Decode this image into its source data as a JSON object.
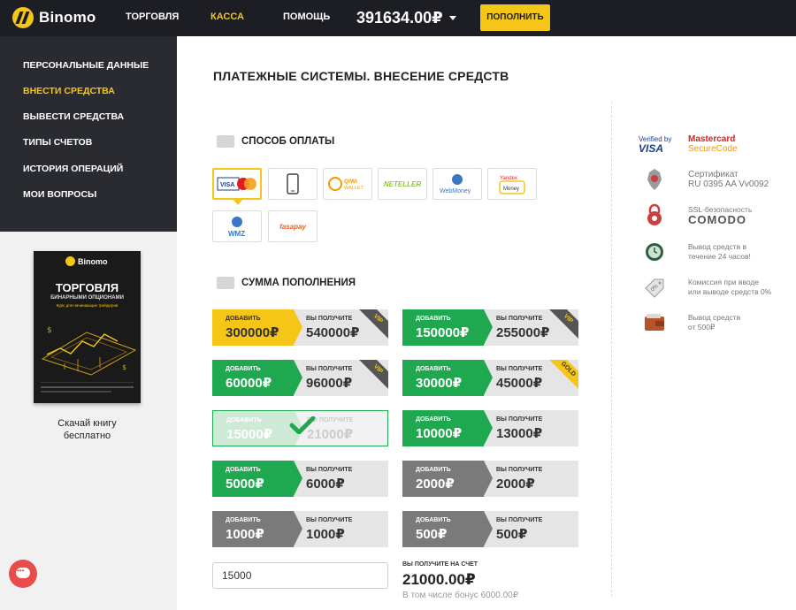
{
  "header": {
    "logo_text": "Binomo",
    "nav": [
      "ТОРГОВЛЯ",
      "КАССА",
      "ПОМОЩЬ"
    ],
    "active_nav": "КАССА",
    "balance": "391634.00₽",
    "deposit_button": "ПОПОЛНИТЬ"
  },
  "sidebar": {
    "items": [
      {
        "label": "ПЕРСОНАЛЬНЫЕ ДАННЫЕ",
        "active": false
      },
      {
        "label": "ВНЕСТИ СРЕДСТВА",
        "active": true
      },
      {
        "label": "ВЫВЕСТИ СРЕДСТВА",
        "active": false
      },
      {
        "label": "ТИПЫ СЧЕТОВ",
        "active": false
      },
      {
        "label": "ИСТОРИЯ ОПЕРАЦИЙ",
        "active": false
      },
      {
        "label": "МОИ ВОПРОСЫ",
        "active": false
      }
    ],
    "book": {
      "logo": "Binomo",
      "title": "ТОРГОВЛЯ",
      "subtitle": "БИНАРНЫМИ ОПЦИОНАМИ",
      "tagline": "Курс для начинающих трейдеров",
      "caption_line1": "Скачай книгу",
      "caption_line2": "бесплатно"
    }
  },
  "main": {
    "title": "ПЛАТЕЖНЫЕ СИСТЕМЫ. ВНЕСЕНИЕ СРЕДСТВ",
    "payment_section_label": "СПОСОБ ОПЛАТЫ",
    "payment_methods": [
      {
        "name": "VISA / MasterCard",
        "icon": "visa-mastercard-icon",
        "selected": true
      },
      {
        "name": "Mobile",
        "icon": "mobile-phone-icon",
        "selected": false
      },
      {
        "name": "QIWI WALLET",
        "icon": "qiwi-icon",
        "selected": false
      },
      {
        "name": "NETELLER",
        "icon": "neteller-icon",
        "selected": false
      },
      {
        "name": "WebMoney",
        "icon": "webmoney-icon",
        "selected": false
      },
      {
        "name": "Yandex Money",
        "icon": "yandex-money-icon",
        "selected": false
      },
      {
        "name": "WMZ",
        "icon": "wmz-icon",
        "selected": false
      },
      {
        "name": "fasapay",
        "icon": "fasapay-icon",
        "selected": false
      }
    ],
    "amount_section_label": "СУММА ПОПОЛНЕНИЯ",
    "add_label": "ДОБАВИТЬ",
    "get_label": "ВЫ ПОЛУЧИТЕ",
    "tiles": [
      {
        "add": "300000₽",
        "get": "540000₽",
        "style": "yellow",
        "ribbon": "VIP"
      },
      {
        "add": "150000₽",
        "get": "255000₽",
        "style": "green",
        "ribbon": "VIP"
      },
      {
        "add": "60000₽",
        "get": "96000₽",
        "style": "green",
        "ribbon": "VIP"
      },
      {
        "add": "30000₽",
        "get": "45000₽",
        "style": "green",
        "ribbon": "GOLD"
      },
      {
        "add": "15000₽",
        "get": "21000₽",
        "style": "selected",
        "ribbon": ""
      },
      {
        "add": "10000₽",
        "get": "13000₽",
        "style": "green",
        "ribbon": ""
      },
      {
        "add": "5000₽",
        "get": "6000₽",
        "style": "green",
        "ribbon": ""
      },
      {
        "add": "2000₽",
        "get": "2000₽",
        "style": "gray",
        "ribbon": ""
      },
      {
        "add": "1000₽",
        "get": "1000₽",
        "style": "gray",
        "ribbon": ""
      },
      {
        "add": "500₽",
        "get": "500₽",
        "style": "gray",
        "ribbon": ""
      }
    ],
    "amount_input_value": "15000",
    "receive_label": "ВЫ ПОЛУЧИТЕ НА СЧЕТ",
    "receive_amount": "21000.00₽",
    "receive_bonus": "В том числе бонус 6000.00₽"
  },
  "trust": {
    "verified_visa_line1": "Verified by",
    "verified_visa_line2": "VISA",
    "mastercard_line1": "Mastercard",
    "mastercard_line2": "SecureCode",
    "certificate_line1": "Сертификат",
    "certificate_line2": "RU 0395 AA Vv0092",
    "ssl_line1": "SSL-безопасность",
    "ssl_line2": "COMODO",
    "withdraw_time_line1": "Вывод средств в",
    "withdraw_time_line2": "течение 24 часов!",
    "commission_line1": "Комиссия при вводе",
    "commission_line2": "или выводе средств 0%",
    "commission_badge": "0%",
    "min_withdraw_line1": "Вывод средств",
    "min_withdraw_line2": "от 500₽"
  },
  "colors": {
    "topbar": "#1d1e23",
    "accent_yellow": "#f5c518",
    "green": "#1fa84f",
    "gray_tile": "#7a7a7a",
    "chat_red": "#e84c4c"
  }
}
